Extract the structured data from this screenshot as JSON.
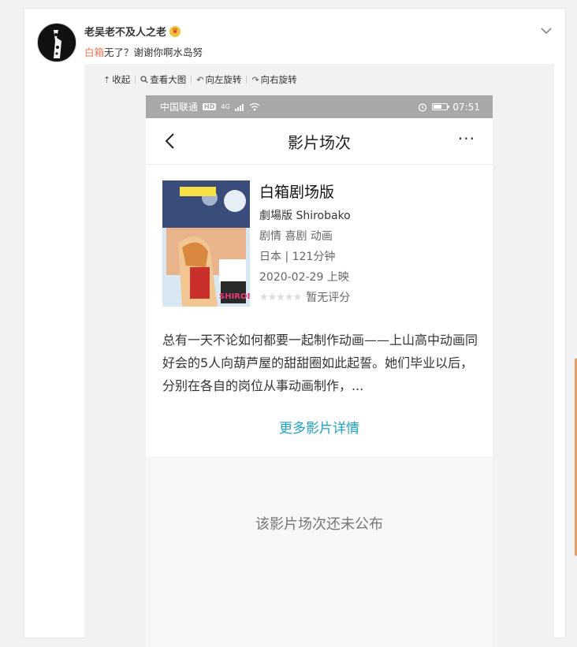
{
  "post": {
    "username": "老吴老不及人之老",
    "text_link": "白箱",
    "text_rest": "无了？谢谢你啊水岛努"
  },
  "toolbar": {
    "collapse": "收起",
    "view_large": "查看大图",
    "rotate_left": "向左旋转",
    "rotate_right": "向右旋转"
  },
  "phone": {
    "status": {
      "carrier": "中国联通",
      "hd": "HD",
      "network": "4G",
      "time": "07:51",
      "battery_level": 0.6
    },
    "nav": {
      "title": "影片场次",
      "more": "···"
    },
    "movie": {
      "title": "白箱剧场版",
      "subtitle": "劇場版 Shirobako",
      "genres": "剧情 喜剧 动画",
      "info": "日本 | 121分钟",
      "release": "2020-02-29 上映",
      "rating_stars": 0,
      "rating_text": "暂无评分",
      "poster_logo": "SHIROBAKO",
      "description": "总有一天不论如何都要一起制作动画——上山高中动画同好会的5人向葫芦屋的甜甜圈如此起誓。她们毕业以后，分别在各自的岗位从事动画制作，...",
      "more_link": "更多影片详情"
    },
    "empty_message": "该影片场次还未公布"
  },
  "colors": {
    "link": "#eb7350",
    "accent": "#1aa3c7",
    "statusbar": "#a8a8a8"
  }
}
